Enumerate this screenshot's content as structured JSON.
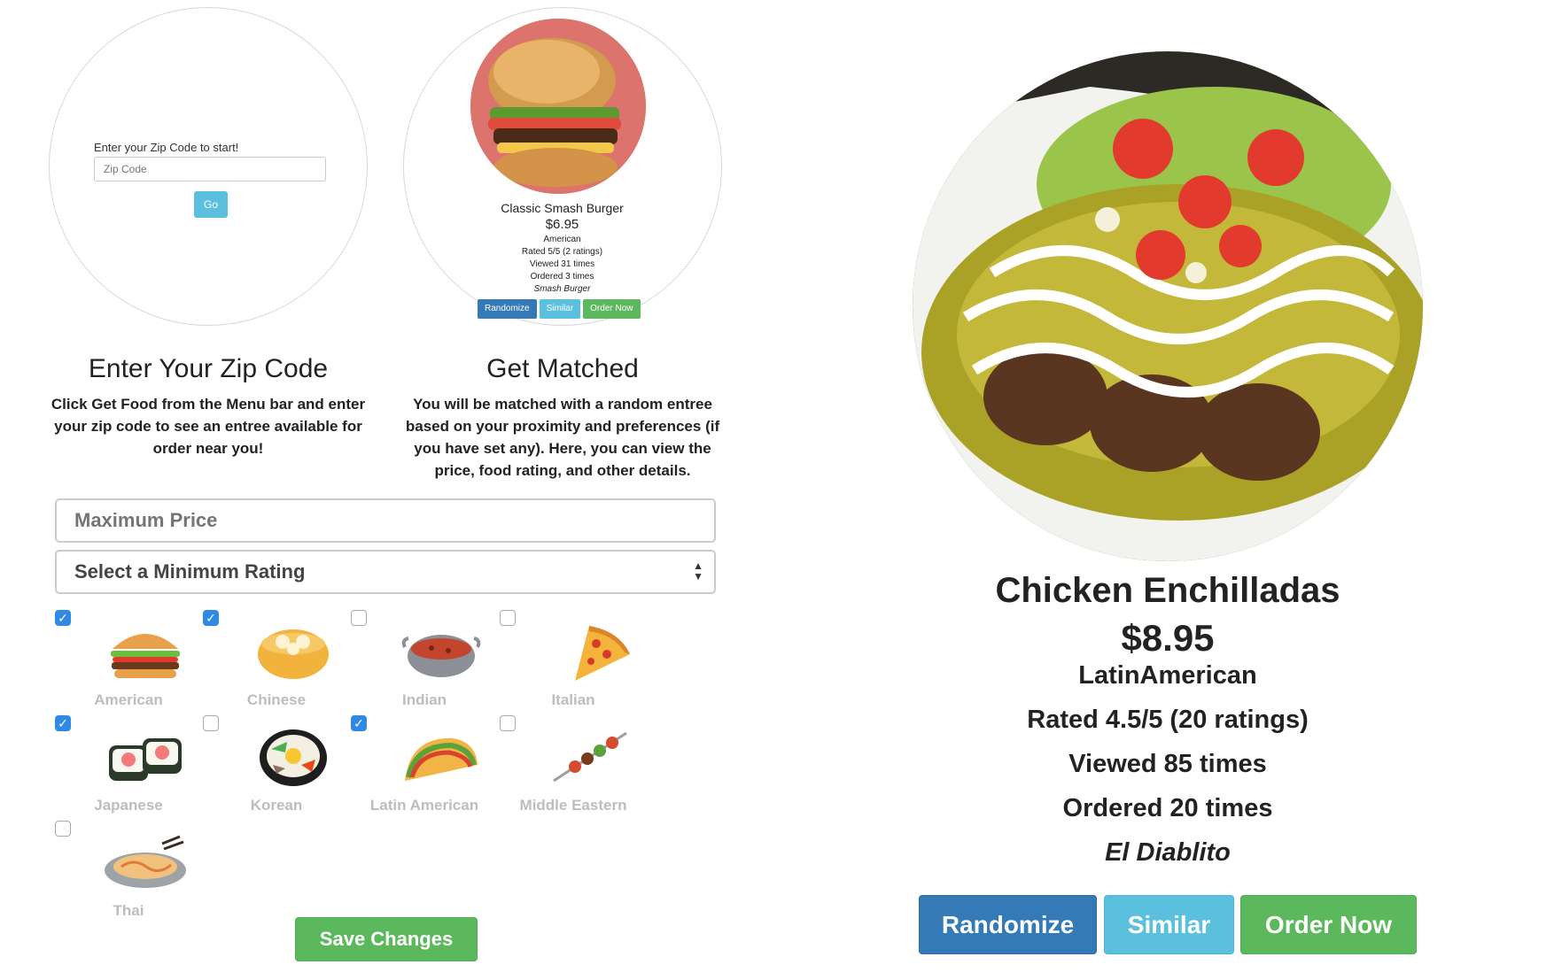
{
  "steps": {
    "zip": {
      "mini_label": "Enter your Zip Code to start!",
      "mini_placeholder": "Zip Code",
      "mini_button": "Go",
      "title": "Enter Your Zip Code",
      "desc_prefix": "Click ",
      "desc_bold": "Get Food",
      "desc_suffix": " from the Menu bar and enter your zip code to see an entree available for order near you!"
    },
    "match": {
      "title": "Get Matched",
      "desc": "You will be matched with a random entree based on your proximity and preferences (if you have set any). Here, you can view the price, food rating, and other details.",
      "preview": {
        "name": "Classic Smash Burger",
        "price": "$6.95",
        "cuisine": "American",
        "rated": "Rated 5/5 (2 ratings)",
        "viewed": "Viewed 31 times",
        "ordered": "Ordered 3 times",
        "restaurant": "Smash Burger",
        "buttons": {
          "randomize": "Randomize",
          "similar": "Similar",
          "order": "Order Now"
        }
      }
    }
  },
  "preferences": {
    "max_price_placeholder": "Maximum Price",
    "min_rating_selected": "Select a Minimum Rating",
    "cuisines": [
      {
        "label": "American",
        "checked": true,
        "icon": "burger-icon"
      },
      {
        "label": "Chinese",
        "checked": true,
        "icon": "dumplings-icon"
      },
      {
        "label": "Indian",
        "checked": false,
        "icon": "curry-pot-icon"
      },
      {
        "label": "Italian",
        "checked": false,
        "icon": "pizza-slice-icon"
      },
      {
        "label": "Japanese",
        "checked": true,
        "icon": "sushi-icon"
      },
      {
        "label": "Korean",
        "checked": false,
        "icon": "bibimbap-icon"
      },
      {
        "label": "Latin American",
        "checked": true,
        "icon": "taco-icon"
      },
      {
        "label": "Middle Eastern",
        "checked": false,
        "icon": "kebab-icon"
      },
      {
        "label": "Thai",
        "checked": false,
        "icon": "pad-thai-icon"
      }
    ],
    "save_label": "Save Changes"
  },
  "result": {
    "name": "Chicken Enchilladas",
    "price": "$8.95",
    "cuisine": "LatinAmerican",
    "rated": "Rated 4.5/5 (20 ratings)",
    "viewed": "Viewed 85 times",
    "ordered": "Ordered 20 times",
    "restaurant": "El Diablito",
    "buttons": {
      "randomize": "Randomize",
      "similar": "Similar",
      "order": "Order Now"
    }
  },
  "colors": {
    "primary": "#337ab7",
    "info": "#5bc0de",
    "success": "#5cb85c",
    "checkbox": "#2f8ae5"
  }
}
